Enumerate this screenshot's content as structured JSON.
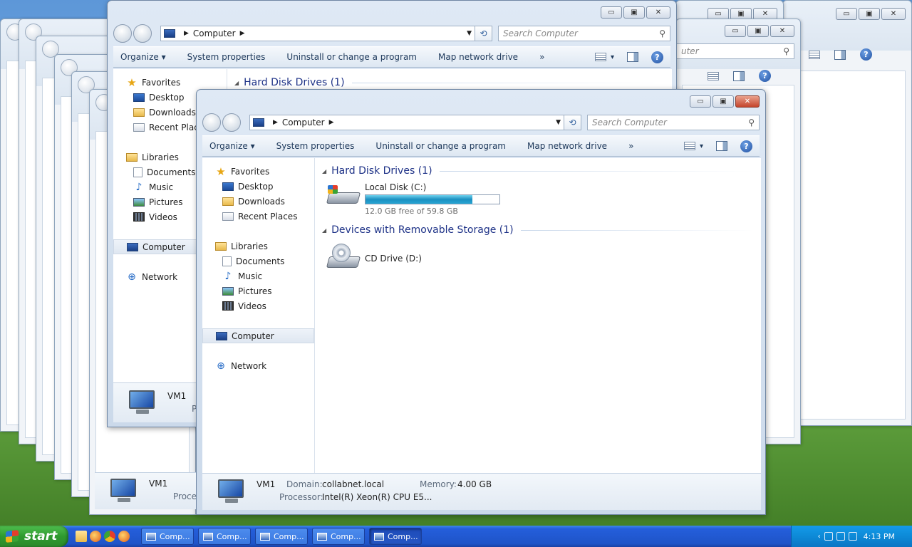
{
  "window": {
    "address": "Computer",
    "search_placeholder": "Search Computer",
    "search_placeholder_partial": "uter"
  },
  "caption_buttons": {
    "minimize": "▭",
    "maximize": "▣",
    "close": "✕"
  },
  "toolbar": {
    "organize": "Organize ▾",
    "system_properties": "System properties",
    "uninstall": "Uninstall or change a program",
    "map_drive": "Map network drive",
    "more": "»",
    "views": "▾",
    "help": "?"
  },
  "nav": {
    "favorites": "Favorites",
    "desktop": "Desktop",
    "downloads": "Downloads",
    "recent": "Recent Places",
    "recent_trunc": "Recent Place",
    "libraries": "Libraries",
    "documents": "Documents",
    "music": "Music",
    "pictures": "Pictures",
    "videos": "Videos",
    "computer": "Computer",
    "network": "Network"
  },
  "groups": {
    "hdd": "Hard Disk Drives (1)",
    "removable": "Devices with Removable Storage (1)"
  },
  "drives": {
    "c_name": "Local Disk (C:)",
    "c_free": "12.0 GB free of 59.8 GB",
    "c_used_fraction": 0.8,
    "d_name": "CD Drive (D:)"
  },
  "details": {
    "name": "VM1",
    "domain_label": "Domain:",
    "domain": "collabnet.local",
    "memory_label": "Memory:",
    "memory": "4.00 GB",
    "processor_label": "Processor:",
    "processor": "Intel(R) Xeon(R) CPU E5...",
    "processor_partial": "P",
    "processor_partial2": "Proce"
  },
  "taskbar": {
    "start": "start",
    "buttons": [
      "Comp...",
      "Comp...",
      "Comp...",
      "Comp...",
      "Comp..."
    ],
    "clock": "4:13 PM"
  }
}
